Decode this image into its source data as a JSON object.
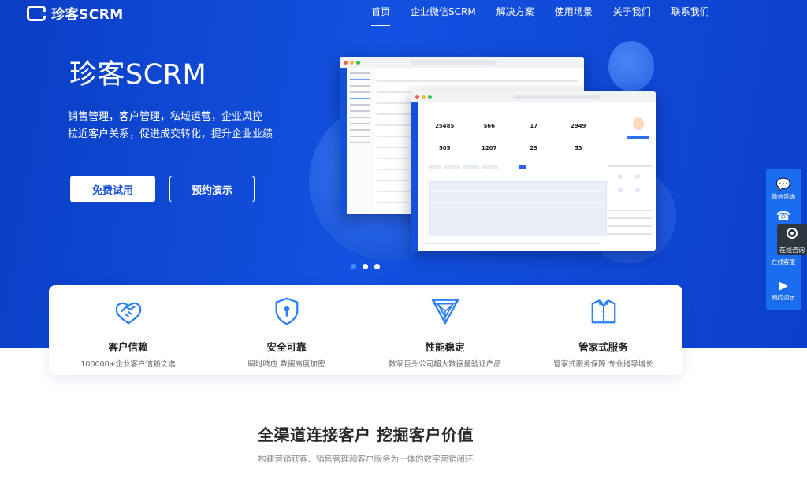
{
  "nav": {
    "logo_text": "珍客SCRM",
    "items": [
      {
        "label": "首页"
      },
      {
        "label": "企业微信SCRM"
      },
      {
        "label": "解决方案"
      },
      {
        "label": "使用场景"
      },
      {
        "label": "关于我们"
      },
      {
        "label": "联系我们"
      }
    ]
  },
  "hero": {
    "title": "珍客SCRM",
    "subtitle_line1": "销售管理，客户管理，私域运营，企业风控",
    "subtitle_line2": "拉近客户关系，促进成交转化，提升企业业绩",
    "btn_free": "免费试用",
    "btn_demo": "预约演示"
  },
  "mockup": {
    "stats": [
      "25485",
      "566",
      "17",
      "2949",
      "505",
      "1207",
      "29",
      "53"
    ]
  },
  "side_tools": {
    "wechat": "微信咨询",
    "phone": "电",
    "online_service": "在线客服",
    "demo": "预约演示",
    "online_chat": "在线咨询"
  },
  "features": [
    {
      "title": "客户信赖",
      "desc": "100000+企业客户信赖之选",
      "icon": "handshake-icon"
    },
    {
      "title": "安全可靠",
      "desc": "瞬时响应 数据高度加密",
      "icon": "shield-icon"
    },
    {
      "title": "性能稳定",
      "desc": "数家巨头公司超大数据量验证产品",
      "icon": "triangle-icon"
    },
    {
      "title": "管家式服务",
      "desc": "管家式服务保障 专业指导增长",
      "icon": "butler-icon"
    }
  ],
  "section": {
    "title": "全渠道连接客户 挖掘客户价值",
    "subtitle": "构建营销获客、销售管理和客户服务为一体的数字营销闭环"
  },
  "colors": {
    "brand": "#1351e0",
    "accent": "#2e80f5",
    "tool_bg": "#1b6df0"
  }
}
